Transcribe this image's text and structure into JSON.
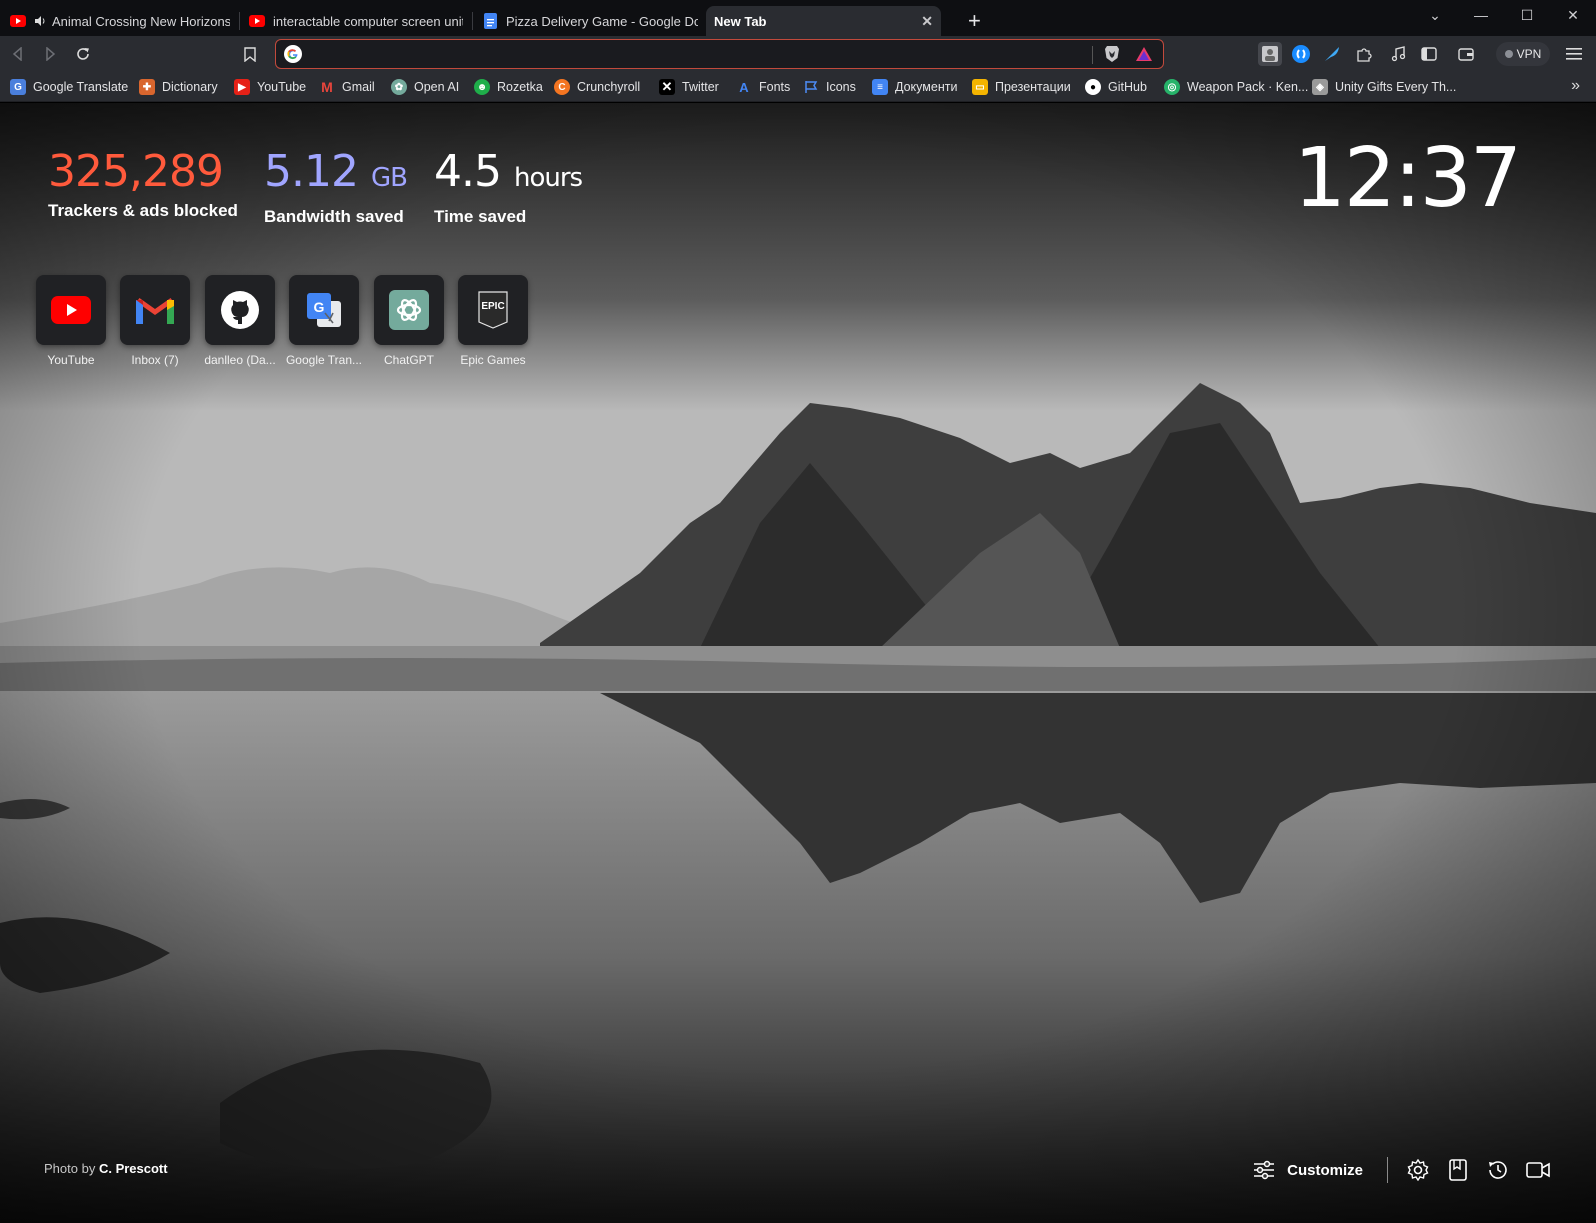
{
  "tabs": [
    {
      "title": "Animal Crossing New Horizons Mu",
      "icon": "youtube-icon",
      "audio": true
    },
    {
      "title": "interactable computer screen unity - Y",
      "icon": "youtube-icon"
    },
    {
      "title": "Pizza Delivery Game - Google Docs",
      "icon": "google-docs-icon"
    },
    {
      "title": "New Tab",
      "icon": "none",
      "active": true,
      "close": "✕"
    }
  ],
  "new_tab_symbol": "+",
  "window_controls": {
    "list": "⌄",
    "minimize": "—",
    "maximize": "☐",
    "close": "✕"
  },
  "address_bar": {
    "value": "",
    "placeholder": ""
  },
  "vpn_label": "VPN",
  "bookmarks": [
    {
      "label": "Google Translate",
      "icon": "google-translate-icon",
      "color": "#4a7fdc"
    },
    {
      "label": "Dictionary",
      "icon": "dictionary-icon",
      "color": "#d9662e"
    },
    {
      "label": "YouTube",
      "icon": "youtube-icon",
      "color": "#e62117"
    },
    {
      "label": "Gmail",
      "icon": "gmail-icon",
      "color": "#e8453c"
    },
    {
      "label": "Open AI",
      "icon": "openai-icon",
      "color": "#74aa9c"
    },
    {
      "label": "Rozetka",
      "icon": "rozetka-icon",
      "color": "#1fae4a"
    },
    {
      "label": "Crunchyroll",
      "icon": "crunchyroll-icon",
      "color": "#f47521"
    },
    {
      "label": "Twitter",
      "icon": "x-icon",
      "color": "#000000"
    },
    {
      "label": "Fonts",
      "icon": "google-fonts-icon",
      "color": "#4285f4"
    },
    {
      "label": "Icons",
      "icon": "flag-icon",
      "color": "#4c8bf5"
    },
    {
      "label": "Документи",
      "icon": "google-docs-icon",
      "color": "#4285f4"
    },
    {
      "label": "Презентации",
      "icon": "google-slides-icon",
      "color": "#f4b400"
    },
    {
      "label": "GitHub",
      "icon": "github-icon",
      "color": "#ffffff"
    },
    {
      "label": "Weapon Pack · Ken...",
      "icon": "circle-icon",
      "color": "#27b36a"
    },
    {
      "label": "Unity Gifts Every Th...",
      "icon": "unity-icon",
      "color": "#9a9a9a"
    }
  ],
  "bookmarks_more": "»",
  "stats": [
    {
      "value": "325,289",
      "unit": "",
      "label": "Trackers & ads blocked",
      "color": "#ff5a3c"
    },
    {
      "value": "5.12",
      "unit": "GB",
      "label": "Bandwidth saved",
      "color": "#a0a5ff"
    },
    {
      "value": "4.5",
      "unit": "hours",
      "label": "Time saved",
      "color": "#ffffff"
    }
  ],
  "clock": "12:37",
  "top_sites": [
    {
      "label": "YouTube",
      "icon": "youtube-icon"
    },
    {
      "label": "Inbox (7)",
      "icon": "gmail-icon"
    },
    {
      "label": "danlleo (Da...",
      "icon": "github-icon"
    },
    {
      "label": "Google Tran...",
      "icon": "google-translate-icon"
    },
    {
      "label": "ChatGPT",
      "icon": "openai-icon"
    },
    {
      "label": "Epic Games",
      "icon": "epic-games-icon"
    }
  ],
  "photo_credit": {
    "prefix": "Photo by",
    "author": "C. Prescott"
  },
  "customize_label": "Customize",
  "epic_text": "EPIC"
}
